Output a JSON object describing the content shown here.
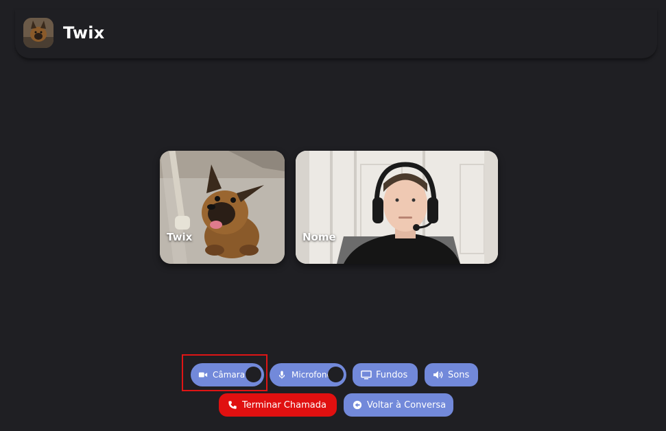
{
  "header": {
    "title": "Twix",
    "avatar_icon": "dog-avatar-icon"
  },
  "tiles": [
    {
      "label": "Twix",
      "kind": "dog-camera"
    },
    {
      "label": "Nome",
      "kind": "person-camera"
    }
  ],
  "controls": {
    "camera_label": "Câmara",
    "microphone_label": "Microfone",
    "backgrounds_label": "Fundos",
    "sounds_label": "Sons",
    "end_call_label": "Terminar Chamada",
    "back_to_chat_label": "Voltar à Conversa"
  },
  "colors": {
    "background": "#1f1f23",
    "accent": "#7289da",
    "danger": "#e01010",
    "highlight": "#e01515"
  }
}
